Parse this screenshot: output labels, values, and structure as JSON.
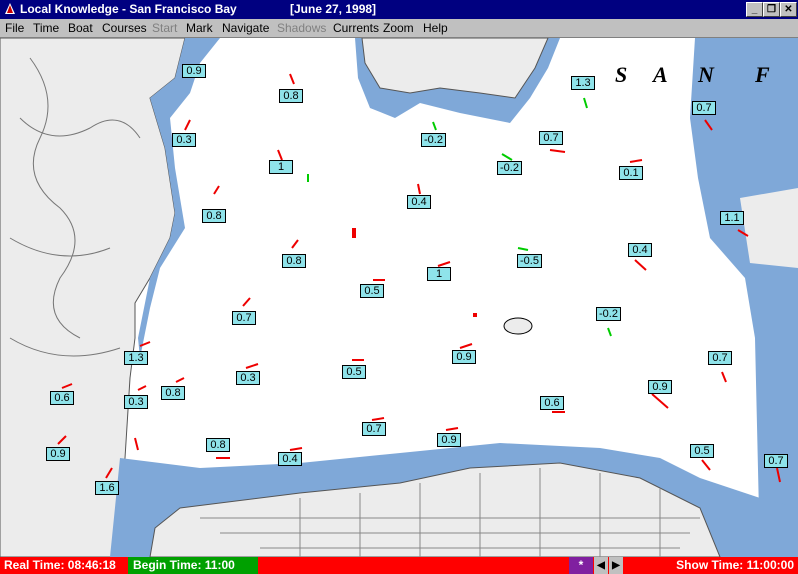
{
  "window": {
    "title": "Local Knowledge - San Francisco Bay",
    "date": "[June 27, 1998]",
    "minimize": "_",
    "restore": "❐",
    "close": "✕"
  },
  "menu": [
    {
      "label": "File",
      "enabled": true
    },
    {
      "label": "Time",
      "enabled": true
    },
    {
      "label": "Boat",
      "enabled": true
    },
    {
      "label": "Courses",
      "enabled": true
    },
    {
      "label": "Start",
      "enabled": false
    },
    {
      "label": "Mark",
      "enabled": true
    },
    {
      "label": "Navigate",
      "enabled": true
    },
    {
      "label": "Shadows",
      "enabled": false
    },
    {
      "label": "Currents",
      "enabled": true
    },
    {
      "label": "Zoom",
      "enabled": true
    },
    {
      "label": "Help",
      "enabled": true
    }
  ],
  "map": {
    "map_letters": [
      "S",
      "A",
      "N",
      "F"
    ],
    "current_labels": [
      "0.9",
      "0.8",
      "1.3",
      "0.7",
      "0.3",
      "-0.2",
      "0.7",
      "1",
      "-0.2",
      "0.1",
      "0.8",
      "0.4",
      "1.1",
      "0.8",
      "-0.5",
      "0.4",
      "0.5",
      "1",
      "0.7",
      "-0.2",
      "1.3",
      "0.9",
      "0.7",
      "0.3",
      "0.5",
      "0.6",
      "0.8",
      "0.9",
      "0.3",
      "0.6",
      "0.7",
      "0.9",
      "0.8",
      "0.4",
      "0.5",
      "1.6",
      "0.7"
    ]
  },
  "status": {
    "real_time": "Real Time: 08:46:18",
    "begin_time": "Begin Time: 11:00",
    "show_time": "Show Time: 11:00:00",
    "star": "*",
    "prev": "◀",
    "next": "▶"
  },
  "colors": {
    "title_bar": "#000080",
    "water_shallow": "#7fa8d8",
    "current_box": "#8fe3ea",
    "status_bar": "#ff0000",
    "begin_time": "#00a000"
  }
}
